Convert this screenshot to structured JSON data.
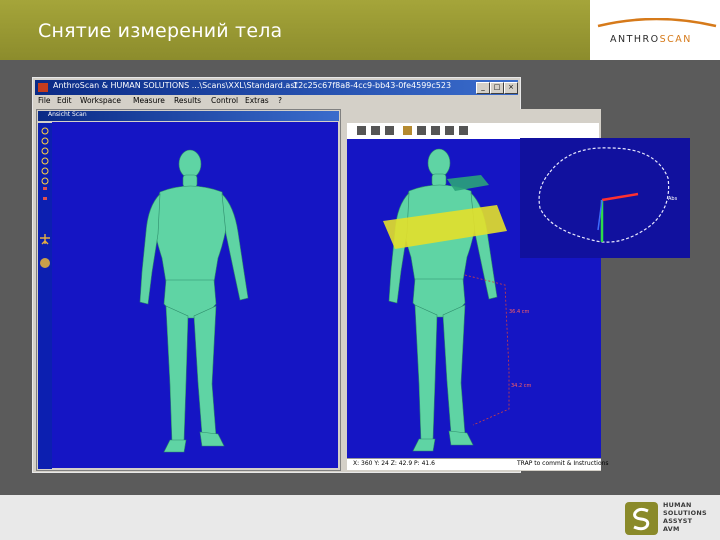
{
  "slide": {
    "title": "Снятие измерений тела",
    "brand_logo": "ANTHROSCAN",
    "footer_logo_lines": [
      "HUMAN",
      "SOLUTIONS",
      "ASSYST",
      "AVM"
    ]
  },
  "app": {
    "title_left": "AnthroScan & HUMAN SOLUTIONS   ...\\Scans\\XXL\\Standard.asf",
    "title_right": "12c25c67f8a8-4cc9-bb43-0fe4599c523",
    "menu": [
      "File",
      "Edit",
      "Workspace",
      "Measure",
      "Results",
      "Control",
      "Extras",
      "?"
    ],
    "window_buttons": [
      "_",
      "□",
      "×"
    ],
    "left_view_title": "Ansicht Scan",
    "status_left": "X: 360 Y: 24  Z: 42.9  P: 41.6",
    "status_right": "TRAP to commit & Instructions",
    "measure_label_1": "36.4 cm",
    "measure_label_2": "34.2 cm",
    "inset_label": "Abs"
  },
  "colors": {
    "header_band": "#9b9b33",
    "viewport_bg": "#1515c4",
    "body_scan": "#5fd4a4",
    "plane_yellow": "#e4e02a",
    "plane_teal": "#2aa37a"
  },
  "icons": [
    "window-app-icon",
    "minimize-icon",
    "maximize-icon",
    "close-icon",
    "toolbar-icons",
    "figure-icon",
    "sphere-icon"
  ]
}
